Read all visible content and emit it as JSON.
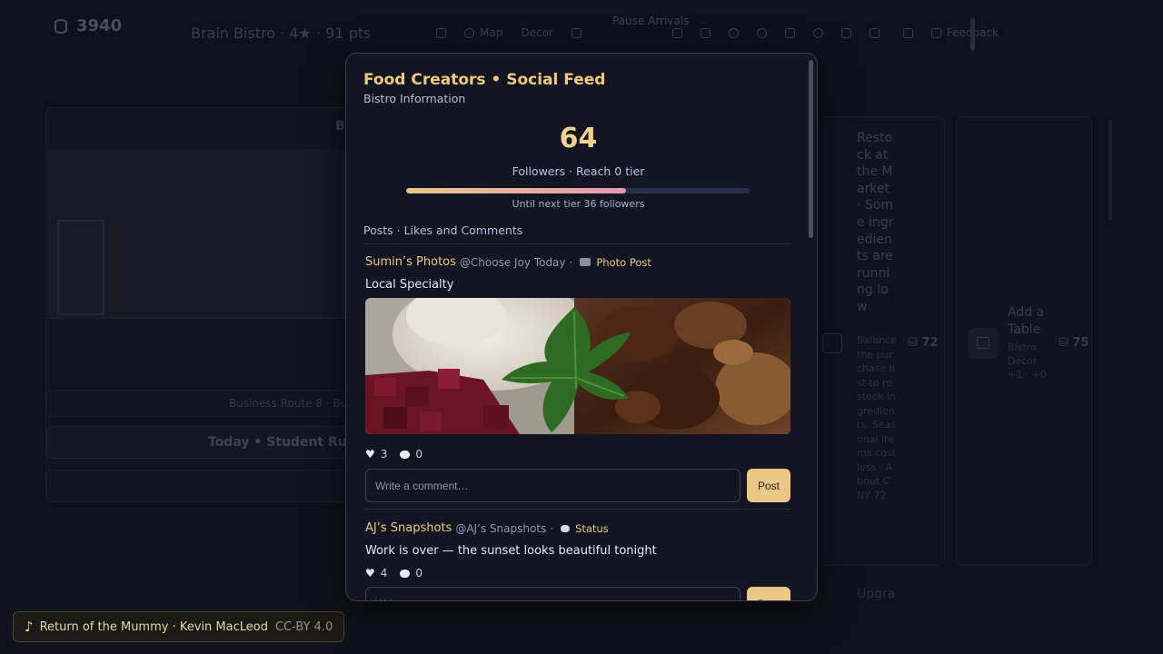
{
  "background": {
    "coins": "3940",
    "bistro_status": "Brain Bistro · 4★ · 91 pts",
    "toolbar": [
      "Map",
      "Decor"
    ],
    "pause_label": "Pause Arrivals",
    "feedback_label": "Feedback",
    "route_text": "Business Route 8 · Bus",
    "today_text": "Today • Student Rush",
    "restock_card": {
      "title": "Restock at the Market · Some ingredients are running low",
      "desc": "Balance the purchase list to restock ingredients. Seasonal items cost less · About CNY 72",
      "cost": "72"
    },
    "table_card": {
      "title": "Add a Table",
      "desc": "Bistro Decor · +1 · +0",
      "cost": "75"
    },
    "upgrade_text": "Upgra"
  },
  "music": {
    "title": "Return of the Mummy · Kevin MacLeod",
    "license": "CC-BY 4.0"
  },
  "modal": {
    "title": "Food Creators • Social Feed",
    "subtitle": "Bistro Information",
    "followers": "64",
    "followers_label": "Followers · Reach 0 tier",
    "progress": 0.64,
    "next_tier": "Until next tier 36 followers",
    "posts_header": "Posts · Likes and Comments",
    "posts": [
      {
        "author": "Sumin’s Photos",
        "handle": "@Choose Joy Today",
        "type": "Photo Post",
        "text": "Local Specialty",
        "likes": "3",
        "comments": "0",
        "comment_placeholder": "Write a comment…",
        "post_label": "Post"
      },
      {
        "author": "AJ’s Snapshots",
        "handle": "@AJ’s Snapshots",
        "type": "Status",
        "text": "Work is over — the sunset looks beautiful tonight",
        "likes": "4",
        "comments": "0",
        "comment_placeholder": "Write a comment…",
        "post_label": "Post"
      }
    ]
  },
  "colors": {
    "accent_gold": "#eccb7a",
    "progress_start": "#e8c884",
    "progress_end": "#e496b8",
    "modal_bg": "#131522"
  }
}
